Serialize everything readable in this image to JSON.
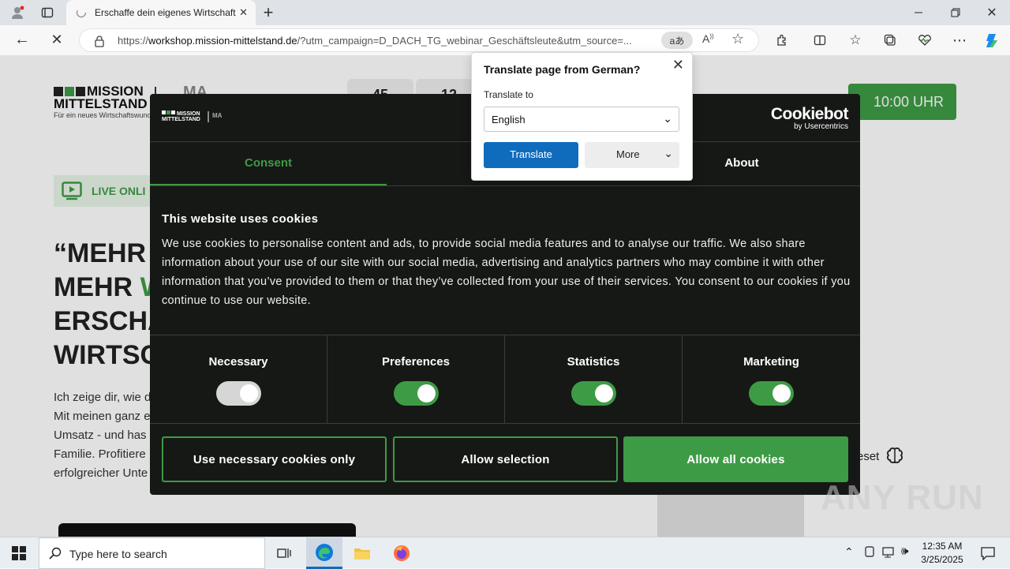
{
  "browser": {
    "tab_title": "Erschaffe dein eigenes Wirtschaft",
    "url_prefix": "https://",
    "url_host": "workshop.mission-mittelstand.de",
    "url_rest": "/?utm_campaign=D_DACH_TG_webinar_Geschäftsleute&utm_source=...",
    "translate_badge": "aあ"
  },
  "page": {
    "logo_line1": "MISSION",
    "logo_line2": "MITTELSTAND",
    "logo_sub": "Für ein neues Wirtschaftswunder",
    "logo_ma": "MA",
    "counters": [
      "45",
      "12"
    ],
    "time_button": "10:00 UHR",
    "live_label": "LIVE ONLI",
    "headline_1": "“MEHR",
    "headline_2a": "MEHR ",
    "headline_2b": "W",
    "headline_3": "ERSCHA",
    "headline_4": "WIRTSC",
    "para_lines": [
      "Ich zeige dir, wie d",
      "Mit meinen ganz e",
      "Umsatz - und has",
      "Familie. Profitiere",
      "erfolgreicher Unte"
    ],
    "reset_label": "eset",
    "watermark": "ANY RUN"
  },
  "cookie": {
    "brand": "Cookiebot",
    "brand_sub": "by Usercentrics",
    "tabs": [
      "Consent",
      "",
      "About"
    ],
    "title": "This website uses cookies",
    "text": "We use cookies to personalise content and ads, to provide social media features and to analyse our traffic. We also share information about your use of our site with our social media, advertising and analytics partners who may combine it with other information that you’ve provided to them or that they’ve collected from your use of their services. You consent to our cookies if you continue to use our website.",
    "categories": [
      {
        "label": "Necessary",
        "enabled": true,
        "locked": true
      },
      {
        "label": "Preferences",
        "enabled": true,
        "locked": false
      },
      {
        "label": "Statistics",
        "enabled": true,
        "locked": false
      },
      {
        "label": "Marketing",
        "enabled": true,
        "locked": false
      }
    ],
    "btn_necessary": "Use necessary cookies only",
    "btn_selection": "Allow selection",
    "btn_all": "Allow all cookies",
    "accent": "#3e9b45"
  },
  "translate": {
    "title": "Translate page from German?",
    "to_label": "Translate to",
    "language": "English",
    "translate_btn": "Translate",
    "more_btn": "More"
  },
  "taskbar": {
    "search_placeholder": "Type here to search",
    "time": "12:35 AM",
    "date": "3/25/2025"
  }
}
